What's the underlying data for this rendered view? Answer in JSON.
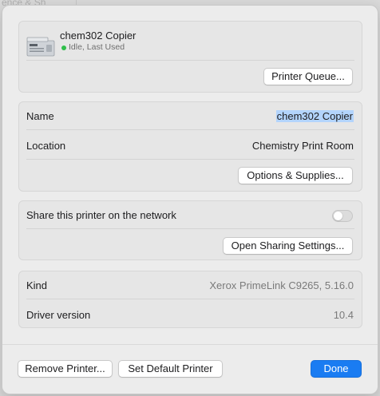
{
  "background": {
    "partial_text": "ence & Sh"
  },
  "printer": {
    "name": "chem302 Copier",
    "status": "Idle, Last Used",
    "status_color": "#2fbf4a",
    "icon": "printer-icon",
    "queue_button": "Printer Queue..."
  },
  "details": {
    "name_label": "Name",
    "name_value": "chem302 Copier",
    "location_label": "Location",
    "location_value": "Chemistry Print Room",
    "options_button": "Options & Supplies..."
  },
  "sharing": {
    "share_label": "Share this printer on the network",
    "share_enabled": false,
    "open_sharing_button": "Open Sharing Settings..."
  },
  "info": {
    "kind_label": "Kind",
    "kind_value": "Xerox PrimeLink C9265, 5.16.0",
    "driver_label": "Driver version",
    "driver_value": "10.4"
  },
  "footer": {
    "remove_button": "Remove Printer...",
    "default_button": "Set Default Printer",
    "done_button": "Done",
    "accent_color": "#1a7cf2"
  }
}
